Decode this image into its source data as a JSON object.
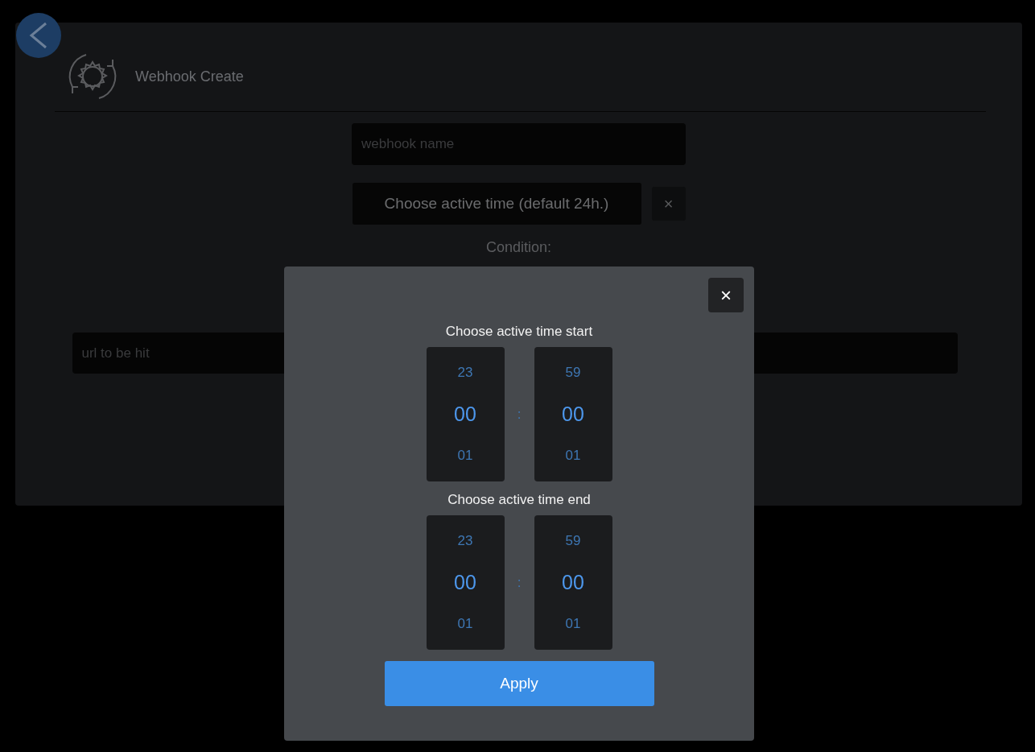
{
  "page": {
    "title": "Webhook Create"
  },
  "form": {
    "name_field": {
      "placeholder": "webhook name"
    },
    "active_time_button": "Choose active time (default 24h.)",
    "clear_button": "×",
    "condition_label": "Condition:",
    "url_field": {
      "placeholder": "url to be hit"
    }
  },
  "dialog": {
    "close_button": "×",
    "pickers": [
      {
        "title": "Choose active time start",
        "separator": ":",
        "hours": [
          {
            "value": "23",
            "selected": false
          },
          {
            "value": "00",
            "selected": true
          },
          {
            "value": "01",
            "selected": false
          }
        ],
        "minutes": [
          {
            "value": "59",
            "selected": false
          },
          {
            "value": "00",
            "selected": true
          },
          {
            "value": "01",
            "selected": false
          }
        ]
      },
      {
        "title": "Choose active time end",
        "separator": ":",
        "hours": [
          {
            "value": "23",
            "selected": false
          },
          {
            "value": "00",
            "selected": true
          },
          {
            "value": "01",
            "selected": false
          }
        ],
        "minutes": [
          {
            "value": "59",
            "selected": false
          },
          {
            "value": "00",
            "selected": true
          },
          {
            "value": "01",
            "selected": false
          }
        ]
      }
    ],
    "apply_button": "Apply"
  }
}
